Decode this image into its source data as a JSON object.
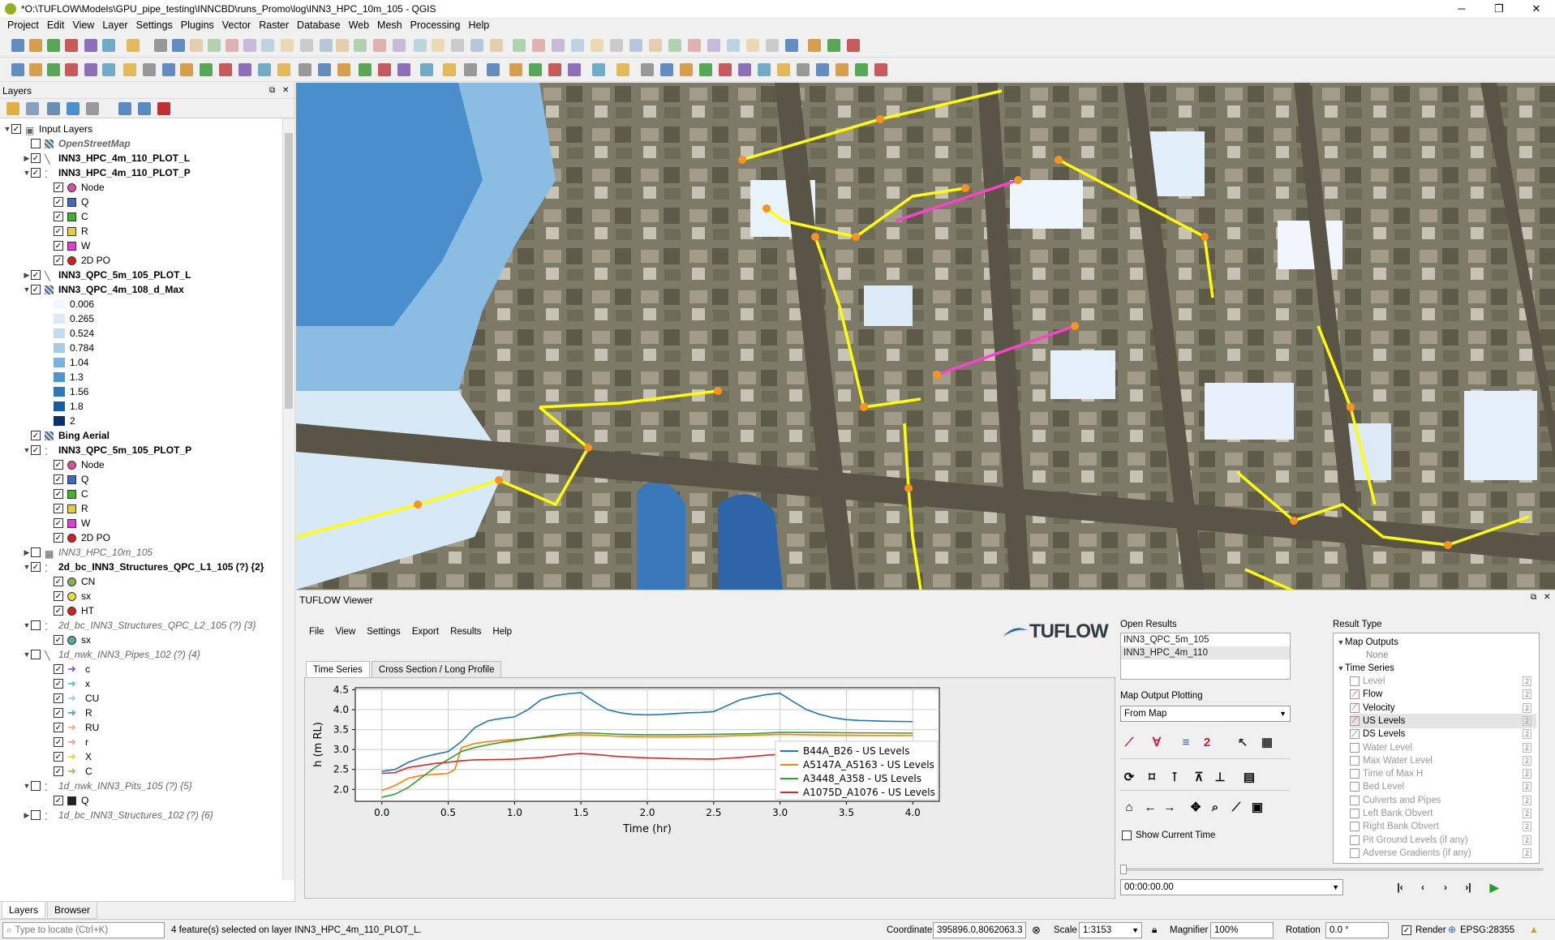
{
  "window": {
    "title": "*O:\\TUFLOW\\Models\\GPU_pipe_testing\\INNCBD\\runs_Promo\\log\\INN3_HPC_10m_105 - QGIS",
    "min": "─",
    "max": "❐",
    "close": "✕"
  },
  "menu": [
    "Project",
    "Edit",
    "View",
    "Layer",
    "Settings",
    "Plugins",
    "Vector",
    "Raster",
    "Database",
    "Web",
    "Mesh",
    "Processing",
    "Help"
  ],
  "layers_panel": {
    "title": "Layers",
    "tabs": [
      "Layers",
      "Browser"
    ],
    "items": [
      {
        "label": "Input Layers",
        "indent": 0,
        "arrow": "▼",
        "checked": true,
        "sym": "group",
        "style": ""
      },
      {
        "label": "OpenStreetMap",
        "indent": 1,
        "arrow": "",
        "checked": false,
        "sym": "raster",
        "style": "ital bold"
      },
      {
        "label": "INN3_HPC_4m_110_PLOT_L",
        "indent": 1,
        "arrow": "▶",
        "checked": true,
        "sym": "line",
        "style": "bold"
      },
      {
        "label": "INN3_HPC_4m_110_PLOT_P",
        "indent": 1,
        "arrow": "▼",
        "checked": true,
        "sym": "point",
        "style": "bold"
      },
      {
        "label": "Node",
        "indent": 2,
        "checked": true,
        "sym": "circle",
        "color": "#d9519b"
      },
      {
        "label": "Q",
        "indent": 2,
        "checked": true,
        "sym": "square",
        "color": "#3f6ac4"
      },
      {
        "label": "C",
        "indent": 2,
        "checked": true,
        "sym": "square",
        "color": "#3db42e"
      },
      {
        "label": "R",
        "indent": 2,
        "checked": true,
        "sym": "square",
        "color": "#e0d13c"
      },
      {
        "label": "W",
        "indent": 2,
        "checked": true,
        "sym": "square",
        "color": "#e73ad4"
      },
      {
        "label": "2D PO",
        "indent": 2,
        "checked": true,
        "sym": "circle",
        "color": "#d52020"
      },
      {
        "label": "INN3_QPC_5m_105_PLOT_L",
        "indent": 1,
        "arrow": "▶",
        "checked": true,
        "sym": "line",
        "style": "bold"
      },
      {
        "label": "INN3_QPC_4m_108_d_Max",
        "indent": 1,
        "arrow": "▼",
        "checked": true,
        "sym": "raster",
        "style": "bold"
      },
      {
        "label": "0.006",
        "indent": 2,
        "sym": "ramp",
        "color": "#f3f7fd"
      },
      {
        "label": "0.265",
        "indent": 2,
        "sym": "ramp",
        "color": "#dde9f6"
      },
      {
        "label": "0.524",
        "indent": 2,
        "sym": "ramp",
        "color": "#c6dbef"
      },
      {
        "label": "0.784",
        "indent": 2,
        "sym": "ramp",
        "color": "#a6cbe3"
      },
      {
        "label": "1.04",
        "indent": 2,
        "sym": "ramp",
        "color": "#79b2da"
      },
      {
        "label": "1.3",
        "indent": 2,
        "sym": "ramp",
        "color": "#4f96cc"
      },
      {
        "label": "1.56",
        "indent": 2,
        "sym": "ramp",
        "color": "#2f78b8"
      },
      {
        "label": "1.8",
        "indent": 2,
        "sym": "ramp",
        "color": "#165ca3"
      },
      {
        "label": "2",
        "indent": 2,
        "sym": "ramp",
        "color": "#08306b"
      },
      {
        "label": "Bing Aerial",
        "indent": 1,
        "arrow": "",
        "checked": true,
        "sym": "raster",
        "style": "bold"
      },
      {
        "label": "INN3_QPC_5m_105_PLOT_P",
        "indent": 1,
        "arrow": "▼",
        "checked": true,
        "sym": "point",
        "style": "bold"
      },
      {
        "label": "Node",
        "indent": 2,
        "checked": true,
        "sym": "circle",
        "color": "#d9519b"
      },
      {
        "label": "Q",
        "indent": 2,
        "checked": true,
        "sym": "square",
        "color": "#3f6ac4"
      },
      {
        "label": "C",
        "indent": 2,
        "checked": true,
        "sym": "square",
        "color": "#3db42e"
      },
      {
        "label": "R",
        "indent": 2,
        "checked": true,
        "sym": "square",
        "color": "#e0d13c"
      },
      {
        "label": "W",
        "indent": 2,
        "checked": true,
        "sym": "square",
        "color": "#e73ad4"
      },
      {
        "label": "2D PO",
        "indent": 2,
        "checked": true,
        "sym": "circle",
        "color": "#d52020"
      },
      {
        "label": "INN3_HPC_10m_105",
        "indent": 1,
        "arrow": "▶",
        "checked": false,
        "sym": "mesh",
        "style": "ital"
      },
      {
        "label": "2d_bc_INN3_Structures_QPC_L1_105 (?) {2}",
        "indent": 1,
        "arrow": "▼",
        "checked": true,
        "sym": "point",
        "style": "bold"
      },
      {
        "label": "CN",
        "indent": 2,
        "checked": true,
        "sym": "circle",
        "color": "#8ab14a"
      },
      {
        "label": "sx",
        "indent": 2,
        "checked": true,
        "sym": "circle",
        "color": "#e2df3a"
      },
      {
        "label": "HT",
        "indent": 2,
        "checked": true,
        "sym": "circle",
        "color": "#d52020"
      },
      {
        "label": "2d_bc_INN3_Structures_QPC_L2_105 (?) {3}",
        "indent": 1,
        "arrow": "▼",
        "checked": false,
        "sym": "point",
        "style": "ital"
      },
      {
        "label": "sx",
        "indent": 2,
        "checked": true,
        "sym": "circle",
        "color": "#5aa9a0"
      },
      {
        "label": "1d_nwk_INN3_Pipes_102 (?) {4}",
        "indent": 1,
        "arrow": "▼",
        "checked": false,
        "sym": "line",
        "style": "ital"
      },
      {
        "label": "c",
        "indent": 2,
        "checked": true,
        "sym": "arrow",
        "color": "#7a4fd8"
      },
      {
        "label": "x",
        "indent": 2,
        "checked": true,
        "sym": "arrow",
        "color": "#5cc4b0"
      },
      {
        "label": "CU",
        "indent": 2,
        "checked": true,
        "sym": "arrow",
        "color": "#9ad4c8"
      },
      {
        "label": "R",
        "indent": 2,
        "checked": true,
        "sym": "arrow",
        "color": "#3fae8a"
      },
      {
        "label": "RU",
        "indent": 2,
        "checked": true,
        "sym": "arrow",
        "color": "#e8b07a"
      },
      {
        "label": "r",
        "indent": 2,
        "checked": true,
        "sym": "arrow",
        "color": "#d9a880"
      },
      {
        "label": "X",
        "indent": 2,
        "checked": true,
        "sym": "arrow",
        "color": "#e8d13a"
      },
      {
        "label": "C",
        "indent": 2,
        "checked": true,
        "sym": "arrow",
        "color": "#8ac45a"
      },
      {
        "label": "1d_nwk_INN3_Pits_105 (?) {5}",
        "indent": 1,
        "arrow": "▼",
        "checked": false,
        "sym": "point",
        "style": "ital"
      },
      {
        "label": "Q",
        "indent": 2,
        "checked": true,
        "sym": "square",
        "color": "#222"
      },
      {
        "label": "1d_bc_INN3_Structures_102 (?) {6}",
        "indent": 1,
        "arrow": "▶",
        "checked": false,
        "sym": "point",
        "style": "ital"
      }
    ]
  },
  "tuflow": {
    "title": "TUFLOW Viewer",
    "menu": [
      "File",
      "View",
      "Settings",
      "Export",
      "Results",
      "Help"
    ],
    "logo": "TUFLOW",
    "tabs": [
      "Time Series",
      "Cross Section / Long Profile"
    ],
    "open_results_label": "Open Results",
    "open_results": [
      "INN3_QPC_5m_105",
      "INN3_HPC_4m_110"
    ],
    "map_output_plotting_label": "Map Output Plotting",
    "map_output_plotting_value": "From Map",
    "show_current_time": "Show Current Time",
    "time_value": "00:00:00.00",
    "result_type_label": "Result Type",
    "map_outputs": "Map Outputs",
    "map_outputs_none": "None",
    "time_series": "Time Series",
    "result_types": [
      {
        "label": "Level",
        "active": false,
        "checked": false
      },
      {
        "label": "Flow",
        "active": true,
        "checked": false
      },
      {
        "label": "Velocity",
        "active": true,
        "checked": false
      },
      {
        "label": "US Levels",
        "active": true,
        "checked": true
      },
      {
        "label": "DS Levels",
        "active": true,
        "checked": false
      },
      {
        "label": "Water Level",
        "active": false,
        "checked": false
      },
      {
        "label": "Max Water Level",
        "active": false,
        "checked": false
      },
      {
        "label": "Time of Max H",
        "active": false,
        "checked": false
      },
      {
        "label": "Bed Level",
        "active": false,
        "checked": false
      },
      {
        "label": "Culverts and Pipes",
        "active": false,
        "checked": false
      },
      {
        "label": "Left Bank Obvert",
        "active": false,
        "checked": false
      },
      {
        "label": "Right Bank Obvert",
        "active": false,
        "checked": false
      },
      {
        "label": "Pit Ground Levels (if any)",
        "active": false,
        "checked": false
      },
      {
        "label": "Adverse Gradients (if any)",
        "active": false,
        "checked": false
      }
    ]
  },
  "chart_data": {
    "type": "line",
    "xlabel": "Time (hr)",
    "ylabel": "h (m RL)",
    "xlim": [
      -0.2,
      4.2
    ],
    "ylim": [
      1.7,
      4.55
    ],
    "xticks": [
      "0.0",
      "0.5",
      "1.0",
      "1.5",
      "2.0",
      "2.5",
      "3.0",
      "3.5",
      "4.0"
    ],
    "yticks": [
      "2.0",
      "2.5",
      "3.0",
      "3.5",
      "4.0",
      "4.5"
    ],
    "legend_position": "bottom-right",
    "series": [
      {
        "name": "B44A_B26 - US Levels",
        "color": "#1f77b4",
        "points": [
          [
            0,
            2.45
          ],
          [
            0.1,
            2.5
          ],
          [
            0.2,
            2.68
          ],
          [
            0.3,
            2.8
          ],
          [
            0.4,
            2.88
          ],
          [
            0.5,
            2.95
          ],
          [
            0.6,
            3.2
          ],
          [
            0.7,
            3.55
          ],
          [
            0.8,
            3.72
          ],
          [
            0.9,
            3.78
          ],
          [
            1.0,
            3.82
          ],
          [
            1.1,
            4.0
          ],
          [
            1.2,
            4.25
          ],
          [
            1.3,
            4.35
          ],
          [
            1.4,
            4.4
          ],
          [
            1.5,
            4.43
          ],
          [
            1.6,
            4.2
          ],
          [
            1.7,
            4.0
          ],
          [
            1.8,
            3.92
          ],
          [
            1.9,
            3.88
          ],
          [
            2.0,
            3.87
          ],
          [
            2.1,
            3.88
          ],
          [
            2.2,
            3.9
          ],
          [
            2.3,
            3.92
          ],
          [
            2.4,
            3.93
          ],
          [
            2.5,
            3.95
          ],
          [
            2.6,
            4.1
          ],
          [
            2.7,
            4.25
          ],
          [
            2.8,
            4.32
          ],
          [
            2.9,
            4.38
          ],
          [
            3.0,
            4.41
          ],
          [
            3.1,
            4.2
          ],
          [
            3.2,
            4.0
          ],
          [
            3.3,
            3.88
          ],
          [
            3.4,
            3.8
          ],
          [
            3.5,
            3.75
          ],
          [
            3.6,
            3.73
          ],
          [
            3.8,
            3.71
          ],
          [
            4.0,
            3.7
          ]
        ]
      },
      {
        "name": "A5147A_A5163 - US Levels",
        "color": "#ff7f0e",
        "points": [
          [
            0,
            1.97
          ],
          [
            0.1,
            2.1
          ],
          [
            0.2,
            2.28
          ],
          [
            0.3,
            2.35
          ],
          [
            0.4,
            2.38
          ],
          [
            0.5,
            2.4
          ],
          [
            0.55,
            2.5
          ],
          [
            0.6,
            3.05
          ],
          [
            0.7,
            3.15
          ],
          [
            0.8,
            3.2
          ],
          [
            0.9,
            3.23
          ],
          [
            1.0,
            3.25
          ],
          [
            1.2,
            3.3
          ],
          [
            1.4,
            3.36
          ],
          [
            1.5,
            3.37
          ],
          [
            1.6,
            3.36
          ],
          [
            1.8,
            3.33
          ],
          [
            2.0,
            3.32
          ],
          [
            2.2,
            3.32
          ],
          [
            2.5,
            3.33
          ],
          [
            2.8,
            3.36
          ],
          [
            3.0,
            3.38
          ],
          [
            3.2,
            3.37
          ],
          [
            3.5,
            3.36
          ],
          [
            3.8,
            3.35
          ],
          [
            4.0,
            3.35
          ]
        ]
      },
      {
        "name": "A3448_A358 - US Levels",
        "color": "#2ca02c",
        "points": [
          [
            0,
            1.8
          ],
          [
            0.1,
            1.88
          ],
          [
            0.2,
            2.05
          ],
          [
            0.3,
            2.3
          ],
          [
            0.4,
            2.55
          ],
          [
            0.5,
            2.75
          ],
          [
            0.6,
            2.95
          ],
          [
            0.7,
            3.05
          ],
          [
            0.8,
            3.12
          ],
          [
            0.9,
            3.18
          ],
          [
            1.0,
            3.22
          ],
          [
            1.2,
            3.32
          ],
          [
            1.4,
            3.4
          ],
          [
            1.5,
            3.42
          ],
          [
            1.6,
            3.41
          ],
          [
            1.8,
            3.38
          ],
          [
            2.0,
            3.37
          ],
          [
            2.2,
            3.37
          ],
          [
            2.5,
            3.38
          ],
          [
            2.8,
            3.4
          ],
          [
            3.0,
            3.43
          ],
          [
            3.2,
            3.43
          ],
          [
            3.5,
            3.42
          ],
          [
            4.0,
            3.41
          ]
        ]
      },
      {
        "name": "A1075D_A1076 - US Levels",
        "color": "#d62728",
        "points": [
          [
            0,
            2.4
          ],
          [
            0.1,
            2.42
          ],
          [
            0.2,
            2.55
          ],
          [
            0.3,
            2.6
          ],
          [
            0.4,
            2.65
          ],
          [
            0.5,
            2.68
          ],
          [
            0.6,
            2.72
          ],
          [
            0.7,
            2.74
          ],
          [
            0.9,
            2.75
          ],
          [
            1.0,
            2.76
          ],
          [
            1.2,
            2.8
          ],
          [
            1.4,
            2.88
          ],
          [
            1.5,
            2.9
          ],
          [
            1.6,
            2.88
          ],
          [
            1.8,
            2.82
          ],
          [
            2.0,
            2.79
          ],
          [
            2.2,
            2.77
          ],
          [
            2.5,
            2.76
          ],
          [
            2.7,
            2.8
          ],
          [
            2.9,
            2.86
          ],
          [
            3.0,
            2.88
          ],
          [
            3.2,
            2.87
          ],
          [
            3.5,
            2.86
          ],
          [
            4.0,
            2.85
          ]
        ]
      }
    ]
  },
  "status": {
    "search_placeholder": "Type to locate (Ctrl+K)",
    "message": "4 feature(s) selected on layer INN3_HPC_4m_110_PLOT_L.",
    "coordinate_label": "Coordinate",
    "coordinate": "395896.0,8062063.3",
    "scale_label": "Scale",
    "scale": "1:3153",
    "magnifier_label": "Magnifier",
    "magnifier": "100%",
    "rotation_label": "Rotation",
    "rotation": "0.0 °",
    "render_label": "Render",
    "crs": "EPSG:28355"
  }
}
